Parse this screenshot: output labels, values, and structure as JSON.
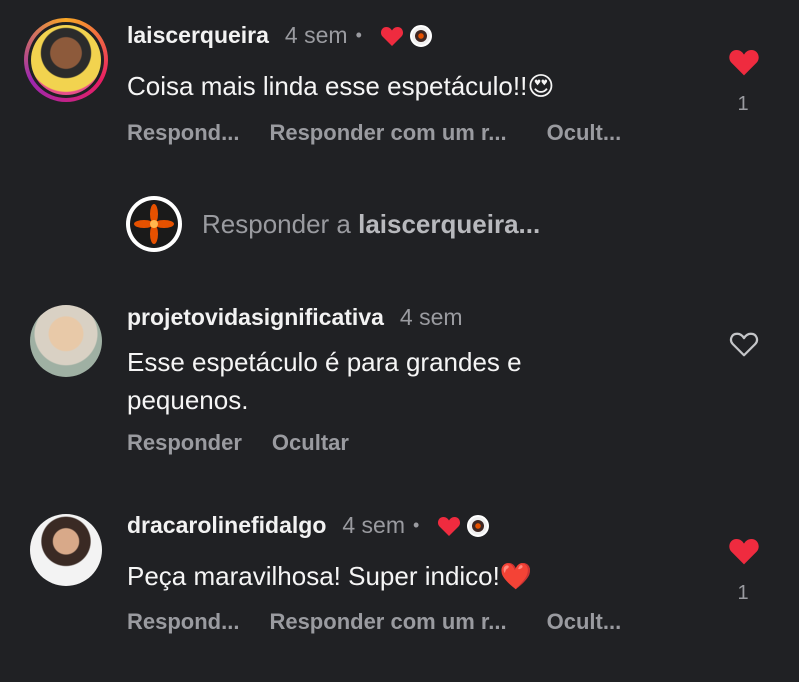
{
  "comments": [
    {
      "username": "laiscerqueira",
      "time": "4 sem",
      "text": "Coisa mais linda esse espetáculo!!😍",
      "actions": [
        "Respond...",
        "Responder com um r...",
        "Ocult..."
      ],
      "liked": true,
      "like_count": "1",
      "author_liked": true
    },
    {
      "username": "projetovidasignificativa",
      "time": "4 sem",
      "text": "Esse espetáculo é para grandes e pequenos.",
      "actions": [
        "Responder",
        "Ocultar"
      ],
      "liked": false,
      "like_count": "",
      "author_liked": false
    },
    {
      "username": "dracarolinefidalgo",
      "time": "4 sem",
      "text": "Peça maravilhosa! Super indico!❤️",
      "actions": [
        "Respond...",
        "Responder com um r...",
        "Ocult..."
      ],
      "liked": true,
      "like_count": "1",
      "author_liked": true
    }
  ],
  "reply": {
    "prefix": "Responder a ",
    "target": "laiscerqueira..."
  },
  "separator": "•",
  "colors": {
    "background": "#202124",
    "heart_red": "#ef2b3f",
    "muted": "#9a9ba0"
  },
  "icons": {
    "like_filled": "heart-filled-icon",
    "like_outline": "heart-outline-icon"
  }
}
